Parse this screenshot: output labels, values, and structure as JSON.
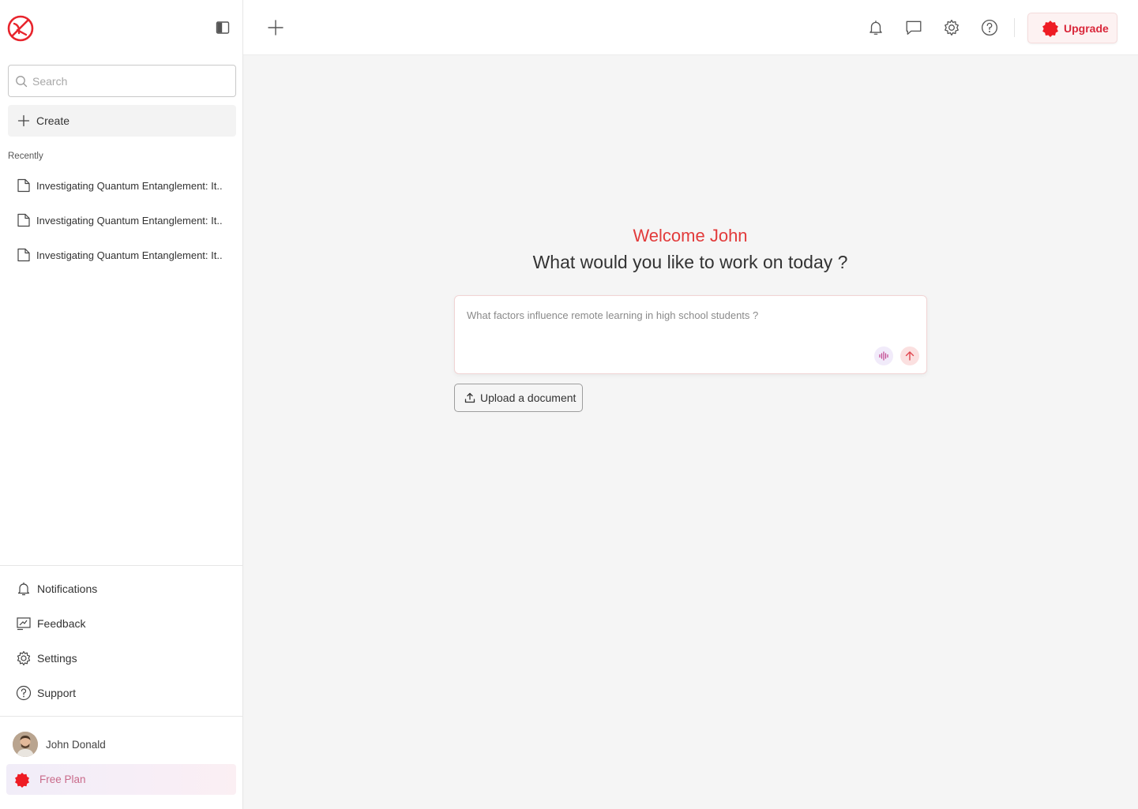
{
  "sidebar": {
    "search_placeholder": "Search",
    "create_label": "Create",
    "recently_label": "Recently",
    "recent_items": [
      {
        "label": "Investigating Quantum Entanglement: It.."
      },
      {
        "label": "Investigating Quantum Entanglement: It.."
      },
      {
        "label": "Investigating Quantum Entanglement: It.."
      }
    ],
    "nav": [
      {
        "label": "Notifications",
        "icon": "bell-icon"
      },
      {
        "label": "Feedback",
        "icon": "feedback-icon"
      },
      {
        "label": "Settings",
        "icon": "gear-icon"
      },
      {
        "label": "Support",
        "icon": "help-icon"
      }
    ],
    "user_name": "John Donald",
    "plan_label": "Free Plan"
  },
  "topbar": {
    "icons": [
      "plus-icon",
      "bell-icon",
      "chat-icon",
      "gear-icon",
      "help-icon"
    ],
    "upgrade_label": "Upgrade"
  },
  "main": {
    "welcome": "Welcome John",
    "question": "What would you like to work on today ?",
    "prompt_placeholder": "What factors influence remote learning in high school students ?",
    "upload_label": "Upload a document"
  },
  "colors": {
    "accent": "#e23b3b",
    "brand_red": "#e8252d",
    "plan_text": "#c96a8a"
  }
}
